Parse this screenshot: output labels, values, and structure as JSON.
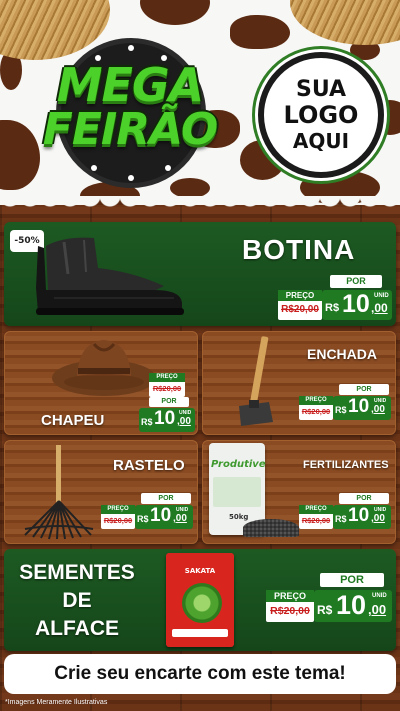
{
  "header": {
    "title_line1": "MEGA",
    "title_line2": "FEIRÃO",
    "logo_line1": "SUA",
    "logo_line2": "LOGO",
    "logo_line3": "AQUI"
  },
  "colors": {
    "green": "#1f7a22",
    "dark_green": "#15461a",
    "red_old_price": "#c81e1e",
    "wood": "#6b3417",
    "cow_spot": "#5b2a12"
  },
  "products": {
    "botina": {
      "name": "BOTINA",
      "discount": "-50%",
      "por": "POR",
      "preco_label": "PREÇO",
      "old_price": "R$20,00",
      "currency": "R$",
      "price_int": "10",
      "price_cents": ",00",
      "unit": "UNID"
    },
    "chapeu": {
      "name": "CHAPEU",
      "por": "POR",
      "preco_label": "PREÇO",
      "old_price": "R$20,00",
      "currency": "R$",
      "price_int": "10",
      "price_cents": ",00",
      "unit": "UNID"
    },
    "enchada": {
      "name": "ENCHADA",
      "por": "POR",
      "preco_label": "PREÇO",
      "old_price": "R$20,00",
      "currency": "R$",
      "price_int": "10",
      "price_cents": ",00",
      "unit": "UNID"
    },
    "rastelo": {
      "name": "RASTELO",
      "por": "POR",
      "preco_label": "PREÇO",
      "old_price": "R$20,00",
      "currency": "R$",
      "price_int": "10",
      "price_cents": ",00",
      "unit": "UNID"
    },
    "fertilizantes": {
      "name": "FERTILIZANTES",
      "bag_brand": "Produtive",
      "bag_weight": "50kg",
      "por": "POR",
      "preco_label": "PREÇO",
      "old_price": "R$20,00",
      "currency": "R$",
      "price_int": "10",
      "price_cents": ",00",
      "unit": "UNID"
    },
    "sementes": {
      "name_line1": "SEMENTES",
      "name_line2": "DE",
      "name_line3": "ALFACE",
      "packet_brand": "SAKATA",
      "por": "POR",
      "preco_label": "PREÇO",
      "old_price": "R$20,00",
      "currency": "R$",
      "price_int": "10",
      "price_cents": ",00",
      "unit": "UNID"
    }
  },
  "footer": {
    "cta": "Crie seu encarte com este tema!",
    "disclaimer": "*Imagens Meramente Ilustrativas"
  }
}
